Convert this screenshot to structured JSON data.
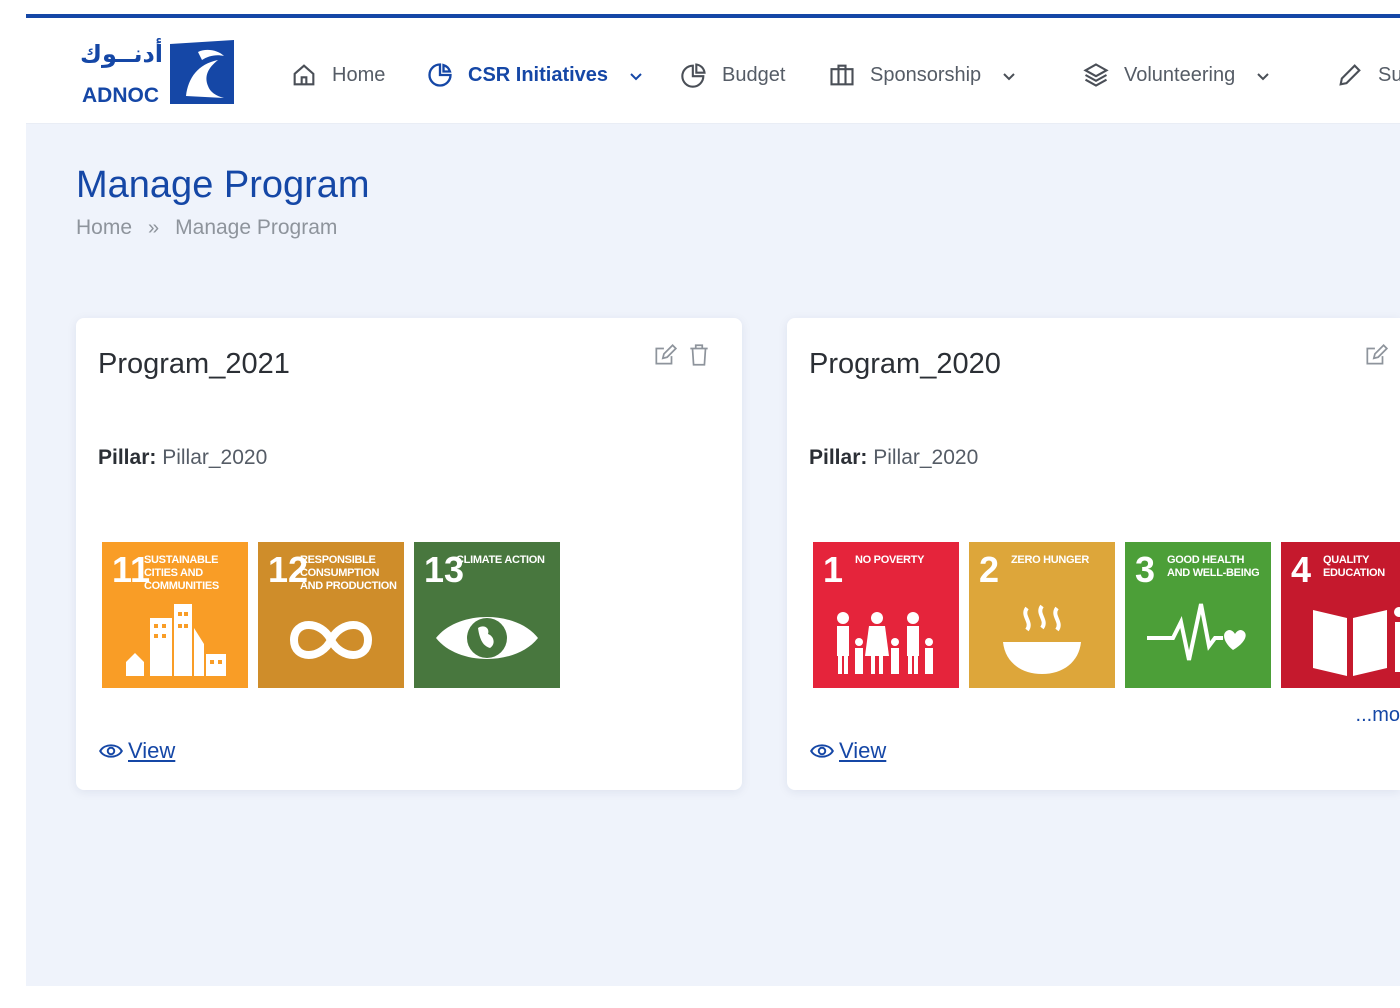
{
  "brand": {
    "arabic": "أدنــوك",
    "name": "ADNOC",
    "color": "#1547a6"
  },
  "nav": [
    {
      "label": "Home",
      "icon": "home-icon",
      "active": false,
      "dropdown": false
    },
    {
      "label": "CSR Initiatives",
      "icon": "pie-chart-icon",
      "active": true,
      "dropdown": true
    },
    {
      "label": "Budget",
      "icon": "pie-chart-icon",
      "active": false,
      "dropdown": false
    },
    {
      "label": "Sponsorship",
      "icon": "briefcase-icon",
      "active": false,
      "dropdown": true
    },
    {
      "label": "Volunteering",
      "icon": "layers-icon",
      "active": false,
      "dropdown": true
    },
    {
      "label": "Su",
      "icon": "pencil-icon",
      "active": false,
      "dropdown": false
    }
  ],
  "page": {
    "title": "Manage Program"
  },
  "breadcrumb": {
    "home": "Home",
    "separator": "»",
    "current": "Manage Program"
  },
  "cards": [
    {
      "title": "Program_2021",
      "pillar_label": "Pillar:",
      "pillar_value": "Pillar_2020",
      "goals": [
        {
          "number": "11",
          "label": "Sustainable cities and communities",
          "color": "#f99d26",
          "icon": "city-icon"
        },
        {
          "number": "12",
          "label": "Responsible consumption and production",
          "color": "#cf8d2a",
          "icon": "infinity-icon"
        },
        {
          "number": "13",
          "label": "Climate action",
          "color": "#48773e",
          "icon": "eye-globe-icon"
        }
      ],
      "more": "",
      "view": "View"
    },
    {
      "title": "Program_2020",
      "pillar_label": "Pillar:",
      "pillar_value": "Pillar_2020",
      "goals": [
        {
          "number": "1",
          "label": "No poverty",
          "color": "#e5243b",
          "icon": "family-icon"
        },
        {
          "number": "2",
          "label": "Zero hunger",
          "color": "#dda63a",
          "icon": "bowl-icon"
        },
        {
          "number": "3",
          "label": "Good health and well-being",
          "color": "#4c9f38",
          "icon": "heartbeat-icon"
        },
        {
          "number": "4",
          "label": "Quality education",
          "color": "#c5192d",
          "icon": "book-icon"
        }
      ],
      "more": "...mo",
      "view": "View"
    }
  ]
}
